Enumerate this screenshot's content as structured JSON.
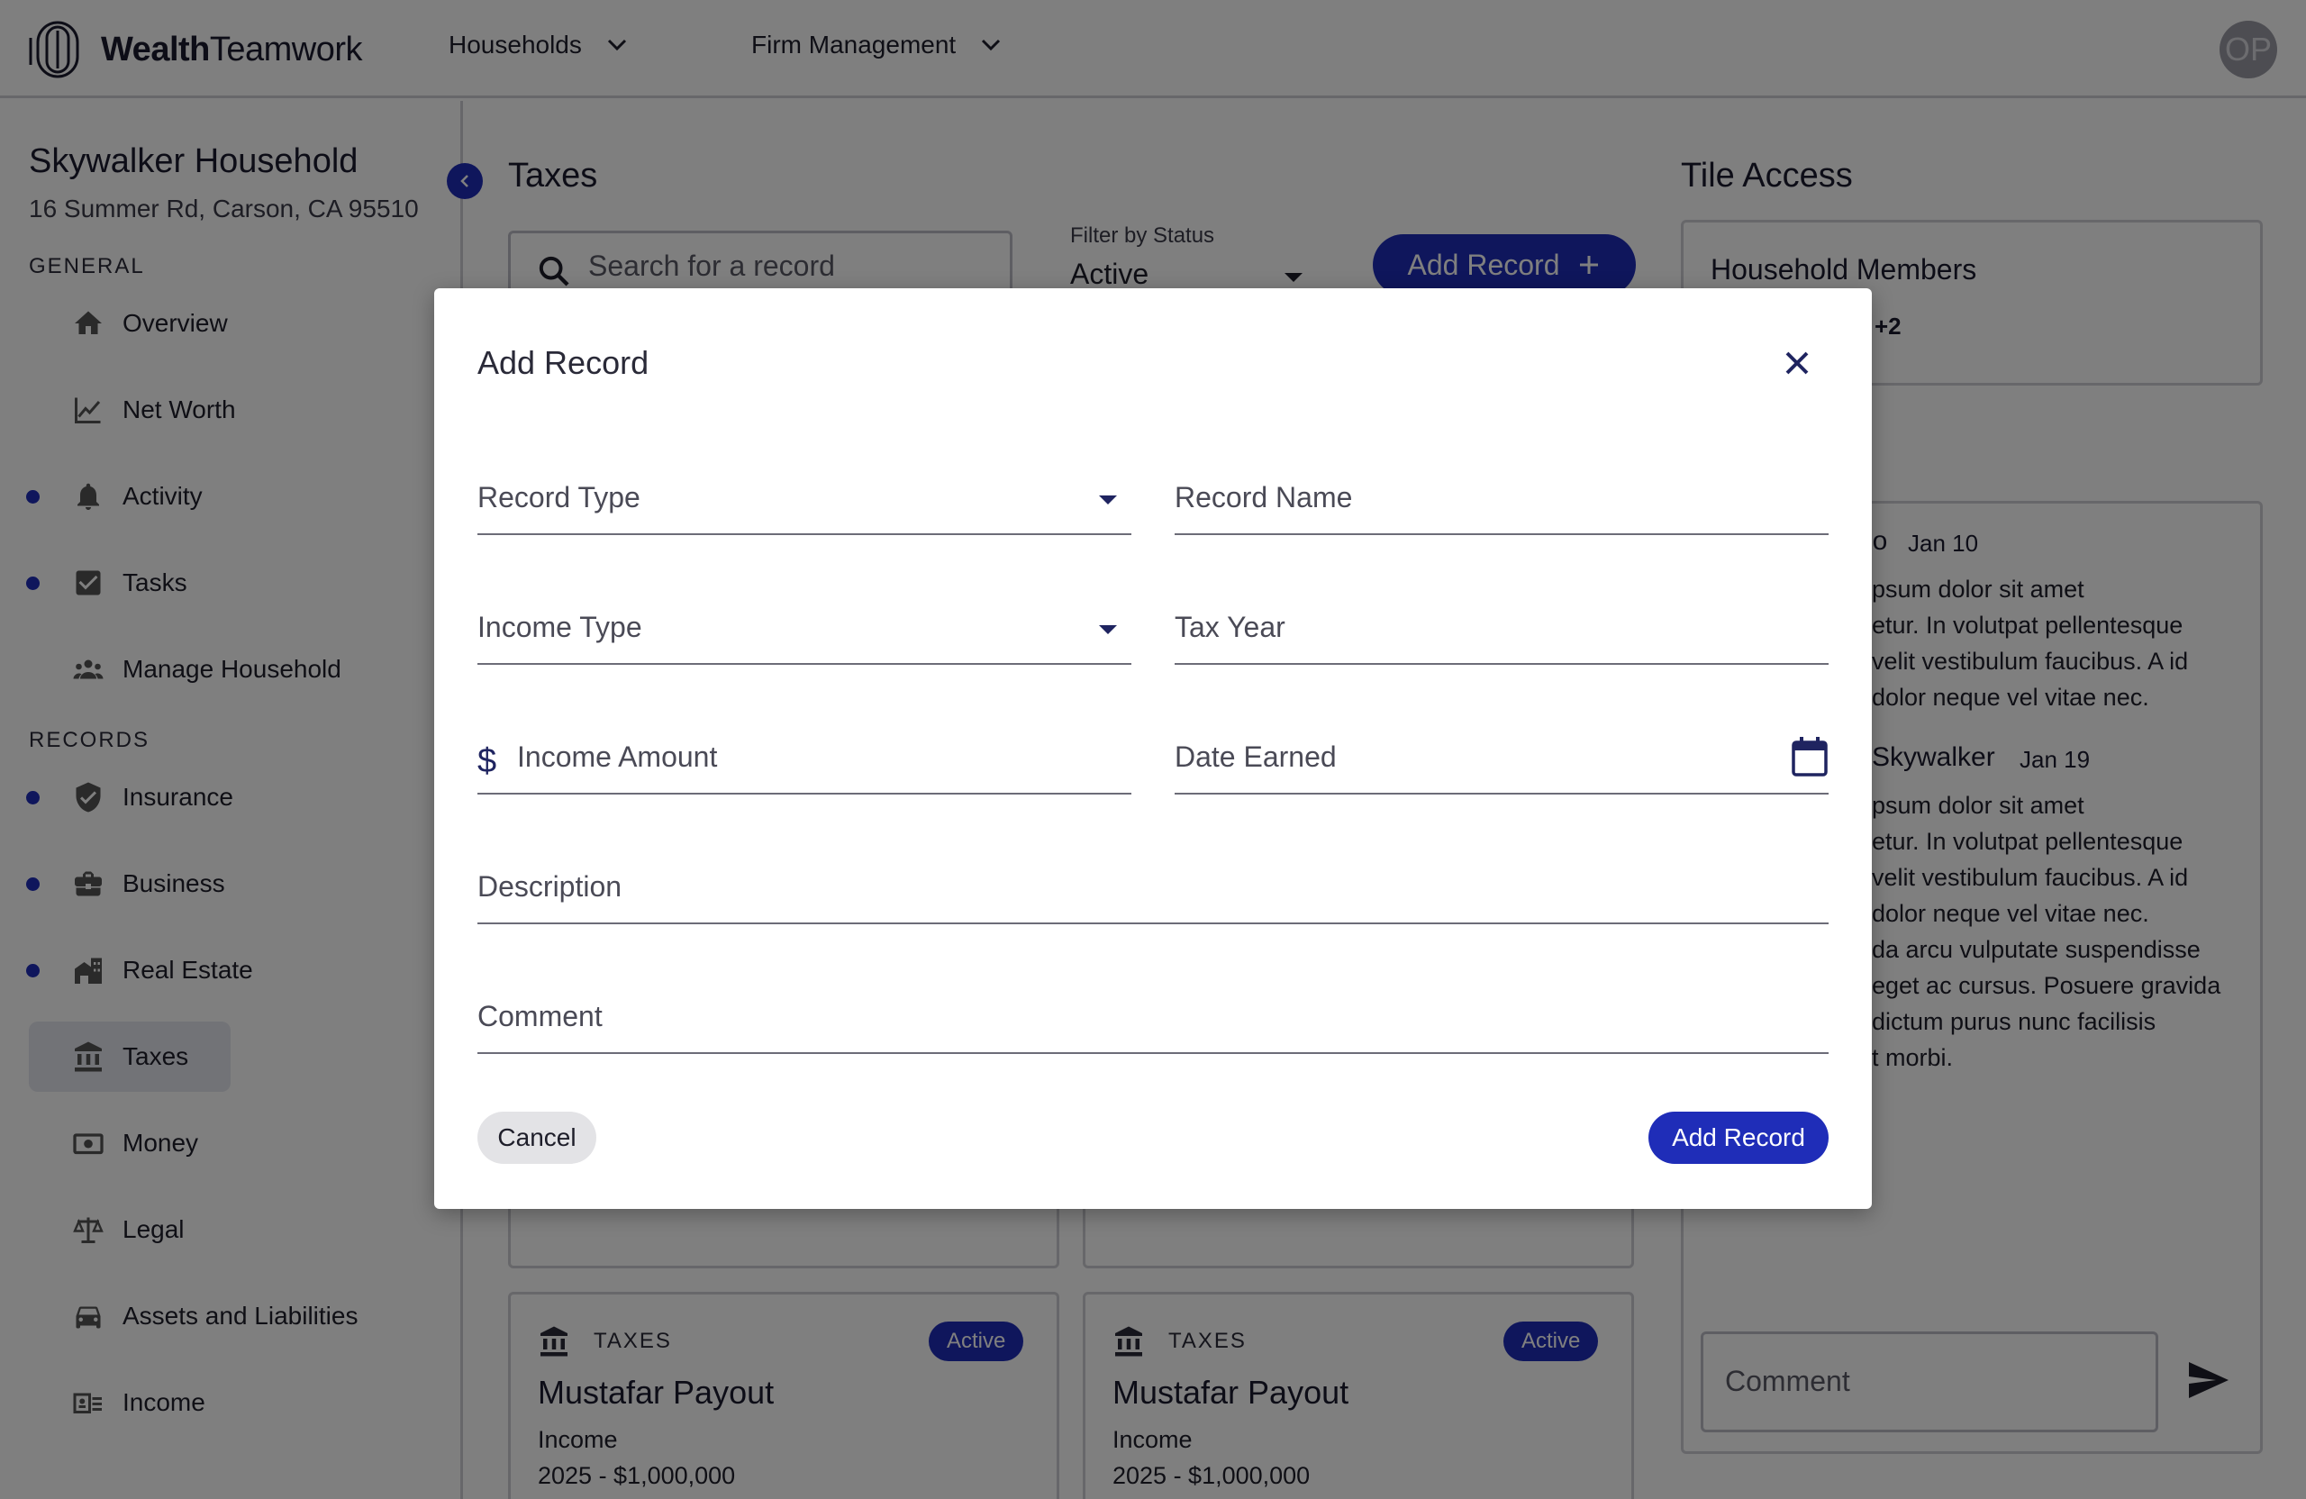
{
  "header": {
    "logo_bold": "Wealth",
    "logo_regular": "Teamwork",
    "nav": [
      {
        "label": "Households"
      },
      {
        "label": "Firm Management"
      }
    ],
    "avatar_initials": "OP"
  },
  "sidebar": {
    "household_name": "Skywalker Household",
    "address": "16 Summer Rd, Carson, CA 95510",
    "general_label": "GENERAL",
    "records_label": "RECORDS",
    "general_items": [
      {
        "label": "Overview",
        "icon": "home-icon",
        "dot": false
      },
      {
        "label": "Net Worth",
        "icon": "chart-line-icon",
        "dot": false
      },
      {
        "label": "Activity",
        "icon": "bell-icon",
        "dot": true
      },
      {
        "label": "Tasks",
        "icon": "checkbox-icon",
        "dot": true
      },
      {
        "label": "Manage Household",
        "icon": "people-icon",
        "dot": false
      }
    ],
    "record_items": [
      {
        "label": "Insurance",
        "icon": "shield-icon",
        "dot": true
      },
      {
        "label": "Business",
        "icon": "briefcase-icon",
        "dot": true
      },
      {
        "label": "Real Estate",
        "icon": "building-icon",
        "dot": true
      },
      {
        "label": "Taxes",
        "icon": "bank-icon",
        "dot": false,
        "selected": true
      },
      {
        "label": "Money",
        "icon": "money-icon",
        "dot": false
      },
      {
        "label": "Legal",
        "icon": "scale-icon",
        "dot": false
      },
      {
        "label": "Assets and Liabilities",
        "icon": "car-icon",
        "dot": false
      },
      {
        "label": "Income",
        "icon": "income-icon",
        "dot": false
      }
    ]
  },
  "main": {
    "title": "Taxes",
    "search_placeholder": "Search for a record",
    "filter_label": "Filter by Status",
    "filter_value": "Active",
    "add_record_label": "Add Record",
    "cards": [
      {
        "type": "TAXES",
        "status": "Active",
        "title": "Mustafar Payout",
        "subtitle": "Income",
        "line": "2025 - $1,000,000"
      },
      {
        "type": "TAXES",
        "status": "Active",
        "title": "Mustafar Payout",
        "subtitle": "Income",
        "line": "2025 - $1,000,000"
      }
    ]
  },
  "right_panel": {
    "tile_access_title": "Tile Access",
    "household_members_label": "Household Members",
    "members_more": "+2",
    "comments": [
      {
        "name": "lo",
        "date": "Jan 10",
        "lines": [
          "psum dolor sit amet",
          "etur. In volutpat pellentesque",
          "velit vestibulum faucibus. A id",
          "dolor neque vel vitae nec."
        ]
      },
      {
        "name": "Skywalker",
        "date": "Jan 19",
        "lines": [
          "psum dolor sit amet",
          "etur. In volutpat pellentesque",
          "velit vestibulum faucibus. A id",
          "dolor neque vel vitae nec.",
          "da arcu vulputate suspendisse",
          "eget ac cursus. Posuere gravida",
          "dictum purus nunc facilisis",
          "t morbi."
        ]
      }
    ],
    "comment_placeholder": "Comment"
  },
  "dialog": {
    "title": "Add Record",
    "fields": {
      "record_type": "Record Type",
      "record_name": "Record Name",
      "income_type": "Income Type",
      "tax_year": "Tax Year",
      "currency_symbol": "$",
      "income_amount": "Income Amount",
      "date_earned": "Date Earned",
      "description": "Description",
      "comment": "Comment"
    },
    "cancel_label": "Cancel",
    "submit_label": "Add Record"
  },
  "colors": {
    "accent": "#1f2db8",
    "overlay": "rgba(0,0,0,0.5)",
    "border": "#cfcfd4"
  }
}
